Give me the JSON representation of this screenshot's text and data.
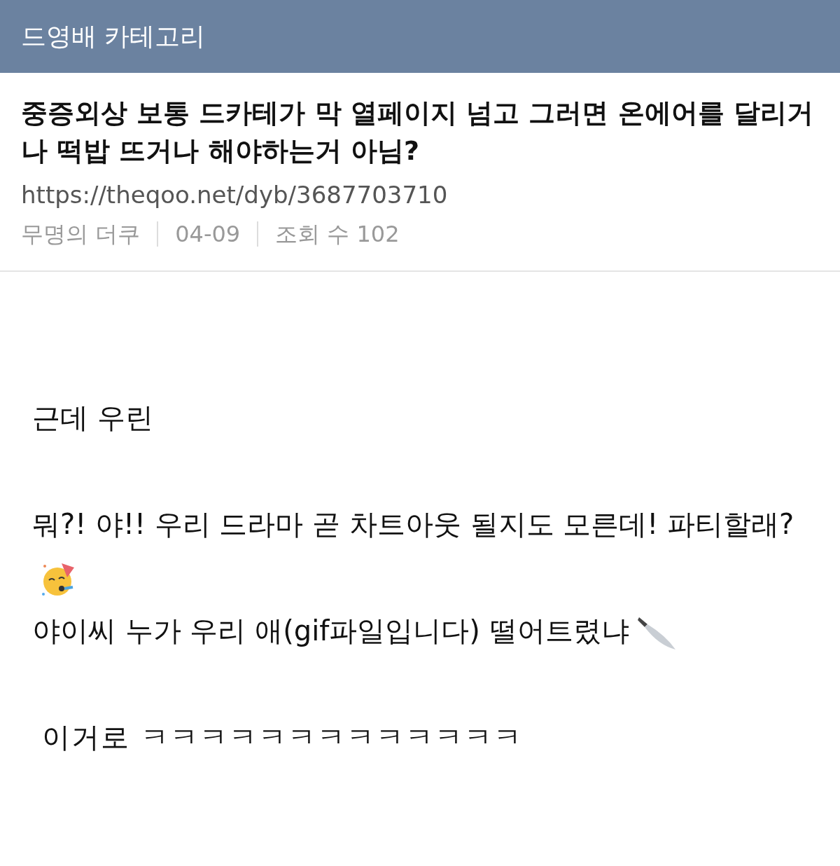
{
  "header": {
    "title": "드영배 카테고리"
  },
  "post": {
    "title": "중증외상 보통 드카테가 막 열페이지 넘고 그러면 온에어를 달리거나 떡밥 뜨거나 해야하는거 아님?",
    "url": "https://theqoo.net/dyb/3687703710",
    "meta": [
      "무명의 더쿠",
      "04-09",
      "조회 수 102"
    ]
  },
  "body": [
    {
      "kind": "text",
      "text": "근데 우린"
    },
    {
      "kind": "gap"
    },
    {
      "kind": "party",
      "text": "뭐?! 야!! 우리 드라마 곧 차트아웃 될지도 모른데! 파티할래?"
    },
    {
      "kind": "knife",
      "text": "야이씨 누가 우리 애(gif파일입니다) 떨어트렸냐"
    },
    {
      "kind": "gap"
    },
    {
      "kind": "indented",
      "text": "이거로 ㅋㅋㅋㅋㅋㅋㅋㅋㅋㅋㅋㅋㅋ"
    }
  ]
}
